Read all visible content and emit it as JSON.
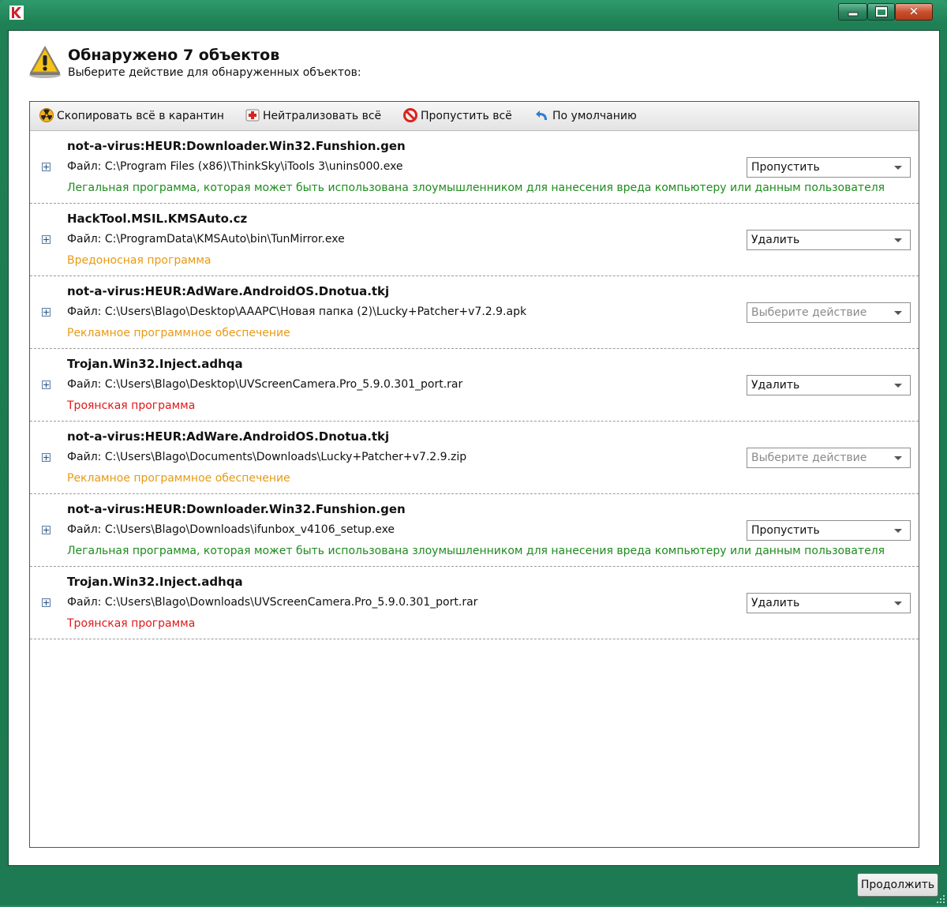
{
  "window": {
    "app_icon": "kaspersky-k-icon",
    "controls": {
      "minimize": "minimize-icon",
      "maximize": "maximize-icon",
      "close": "close-icon"
    }
  },
  "header": {
    "title": "Обнаружено 7 объектов",
    "subtitle": "Выберите действие для обнаруженных объектов:",
    "icon": "warning-icon"
  },
  "toolbar": {
    "quarantine_all": "Скопировать всё в карантин",
    "disinfect_all": "Нейтрализовать всё",
    "skip_all": "Пропустить всё",
    "default": "По умолчанию"
  },
  "colors": {
    "legal": "#1e8c1e",
    "malware": "#e89a14",
    "adware": "#e89a14",
    "trojan": "#e01818",
    "frame": "#1f7f55"
  },
  "threats": [
    {
      "name": "not-a-virus:HEUR:Downloader.Win32.Funshion.gen",
      "file": "Файл: C:\\Program Files (x86)\\ThinkSky\\iTools 3\\unins000.exe",
      "description": "Легальная программа, которая может быть использована злоумышленником для нанесения вреда компьютеру или данным пользователя",
      "desc_color": "#1e8c1e",
      "action": "Пропустить",
      "placeholder": false
    },
    {
      "name": "HackTool.MSIL.KMSAuto.cz",
      "file": "Файл: C:\\ProgramData\\KMSAuto\\bin\\TunMirror.exe",
      "description": "Вредоносная программа",
      "desc_color": "#e89a14",
      "action": "Удалить",
      "placeholder": false
    },
    {
      "name": "not-a-virus:HEUR:AdWare.AndroidOS.Dnotua.tkj",
      "file": "Файл: C:\\Users\\Blago\\Desktop\\AAAPC\\Новая папка (2)\\Lucky+Patcher+v7.2.9.apk",
      "description": "Рекламное программное обеспечение",
      "desc_color": "#e89a14",
      "action": "Выберите действие",
      "placeholder": true
    },
    {
      "name": "Trojan.Win32.Inject.adhqa",
      "file": "Файл: C:\\Users\\Blago\\Desktop\\UVScreenCamera.Pro_5.9.0.301_port.rar",
      "description": "Троянская программа",
      "desc_color": "#e01818",
      "action": "Удалить",
      "placeholder": false
    },
    {
      "name": "not-a-virus:HEUR:AdWare.AndroidOS.Dnotua.tkj",
      "file": "Файл: C:\\Users\\Blago\\Documents\\Downloads\\Lucky+Patcher+v7.2.9.zip",
      "description": "Рекламное программное обеспечение",
      "desc_color": "#e89a14",
      "action": "Выберите действие",
      "placeholder": true
    },
    {
      "name": "not-a-virus:HEUR:Downloader.Win32.Funshion.gen",
      "file": "Файл: C:\\Users\\Blago\\Downloads\\ifunbox_v4106_setup.exe",
      "description": "Легальная программа, которая может быть использована злоумышленником для нанесения вреда компьютеру или данным пользователя",
      "desc_color": "#1e8c1e",
      "action": "Пропустить",
      "placeholder": false
    },
    {
      "name": "Trojan.Win32.Inject.adhqa",
      "file": "Файл: C:\\Users\\Blago\\Downloads\\UVScreenCamera.Pro_5.9.0.301_port.rar",
      "description": "Троянская программа",
      "desc_color": "#e01818",
      "action": "Удалить",
      "placeholder": false
    }
  ],
  "footer": {
    "continue": "Продолжить"
  }
}
